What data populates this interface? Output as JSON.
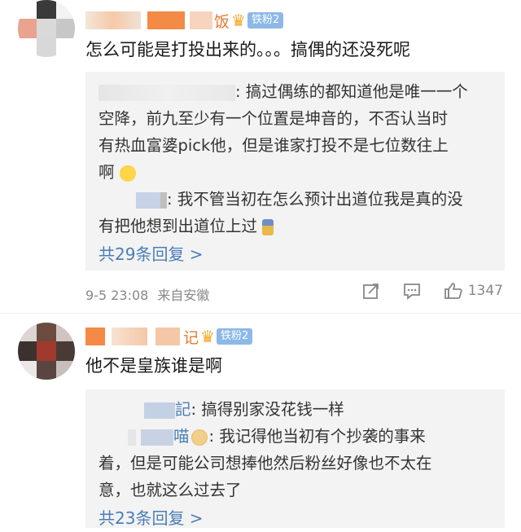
{
  "comments": [
    {
      "text": "怎么可能是打投出来的。。。搞偶的还没死呢",
      "badge": "铁粉2",
      "name_partial": "饭",
      "replies": [
        {
          "text_lines": [
            ": 搞过偶练的都知道他是唯一一个",
            "空降，前九至少有一个位置是坤音的，不否认当时",
            "有热血富婆pick他，但是谁家打投不是七位数往上",
            "啊"
          ]
        },
        {
          "text_lines": [
            ": 我不管当初在怎么预计出道位我是真的没",
            "有把他想到出道位上过"
          ]
        }
      ],
      "more": "共29条回复 >",
      "time": "9-5 23:08",
      "source": "来自安徽",
      "likes": "1347"
    },
    {
      "text": "他不是皇族谁是啊",
      "badge": "铁粉2",
      "name_partial": "记",
      "replies": [
        {
          "name_partial": "記",
          "text_lines": [
            ": 搞得别家没花钱一样"
          ]
        },
        {
          "name_partial": "喵",
          "text_lines": [
            ": 我记得他当初有个抄袭的事来",
            "着，但是可能公司想捧他然后粉丝好像也不太在",
            "意，也就这么过去了"
          ]
        }
      ],
      "more": "共23条回复 >"
    }
  ],
  "icons": {
    "crown": "crown-icon",
    "share": "share-icon",
    "comment": "comment-icon",
    "like": "thumbs-up-icon",
    "emoji_tired": "tired-face-emoji",
    "emoji_figure": "figure-emoji",
    "emoji_dog": "dog-face-emoji"
  },
  "colors": {
    "link": "#4a7db8",
    "badge": "#8db8e8",
    "reply_bg": "#f3f3f3",
    "meta": "#888888"
  }
}
